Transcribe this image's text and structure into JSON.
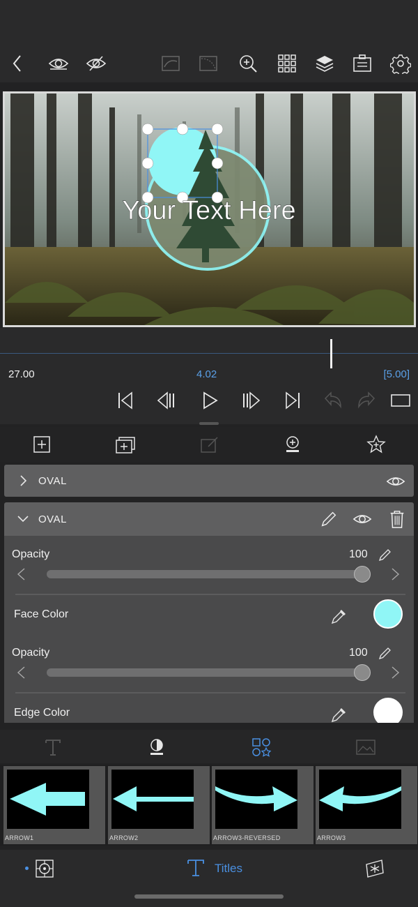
{
  "preview": {
    "overlay_text": "Your Text Here"
  },
  "timeline": {
    "elapsed": "27.00",
    "current": "4.02",
    "duration": "[5.00]"
  },
  "layers": [
    {
      "label": "OVAL",
      "expanded": false
    },
    {
      "label": "OVAL",
      "expanded": true
    }
  ],
  "properties": {
    "opacity_label": "Opacity",
    "opacity_value": "100",
    "face_color_label": "Face Color",
    "face_color": "#90f6f6",
    "opacity2_label": "Opacity",
    "opacity2_value": "100",
    "edge_color_label": "Edge Color",
    "edge_color": "#ffffff"
  },
  "gallery": {
    "items": [
      {
        "name": "ARROW1"
      },
      {
        "name": "ARROW2"
      },
      {
        "name": "ARROW3-REVERSED"
      },
      {
        "name": "ARROW3"
      }
    ]
  },
  "bottom_tab": {
    "active_label": "Titles"
  },
  "colors": {
    "accent": "#4a90e2",
    "shape_cyan": "#90f6f6"
  }
}
